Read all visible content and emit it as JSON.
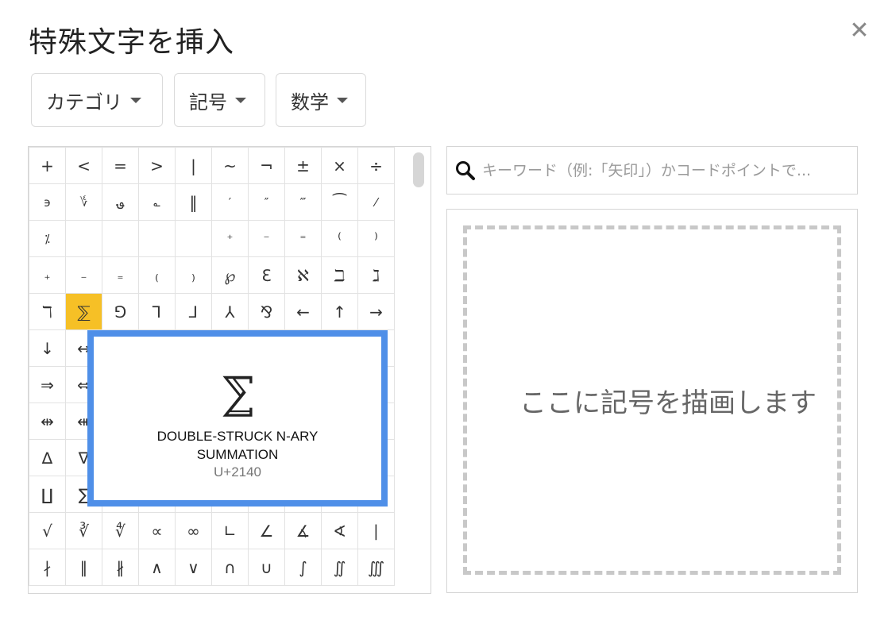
{
  "dialog": {
    "title": "特殊文字を挿入",
    "close_label": "✕"
  },
  "filters": {
    "category": "カテゴリ",
    "symbol": "記号",
    "math": "数学"
  },
  "grid": {
    "selected_index": 41,
    "cells": [
      "+",
      "<",
      "=",
      ">",
      "|",
      "~",
      "¬",
      "±",
      "×",
      "÷",
      "϶",
      "؇",
      "؈",
      "؎",
      "‖",
      "′",
      "″",
      "‴",
      "⁀",
      "⁄",
      "⁒",
      "",
      "",
      "",
      "",
      "⁺",
      "⁻",
      "⁼",
      "⁽",
      "⁾",
      "₊",
      "₋",
      "₌",
      "₍",
      "₎",
      "℘",
      "ℇ",
      "ℵ",
      "ℶ",
      "ℷ",
      "ℸ",
      "⅀",
      "⅁",
      "⅂",
      "⅃",
      "⅄",
      "⅋",
      "←",
      "↑",
      "→",
      "↓",
      "↔",
      "",
      "",
      "",
      "",
      "",
      "",
      "",
      "",
      "⇒",
      "⇔",
      "",
      "",
      "",
      "",
      "",
      "",
      "",
      "",
      "⇹",
      "⇺",
      "",
      "",
      "",
      "",
      "",
      "",
      "",
      "",
      "∆",
      "∇",
      "",
      "",
      "",
      "",
      "",
      "",
      "",
      "",
      "∐",
      "∑",
      "",
      "",
      "",
      "",
      "",
      "",
      "",
      "",
      "√",
      "∛",
      "∜",
      "∝",
      "∞",
      "∟",
      "∠",
      "∡",
      "∢",
      "∣",
      "∤",
      "∥",
      "∦",
      "∧",
      "∨",
      "∩",
      "∪",
      "∫",
      "∬",
      "∭"
    ]
  },
  "tooltip": {
    "glyph": "⅀",
    "name": "DOUBLE-STRUCK N-ARY SUMMATION",
    "code": "U+2140"
  },
  "search": {
    "placeholder": "キーワード（例:「矢印」）かコードポイントで..."
  },
  "draw": {
    "hint": "ここに記号を描画します"
  },
  "colors": {
    "selected_cell": "#f6c026",
    "tooltip_border": "#4f8fe8",
    "dashed_border": "#c8c8c8"
  }
}
